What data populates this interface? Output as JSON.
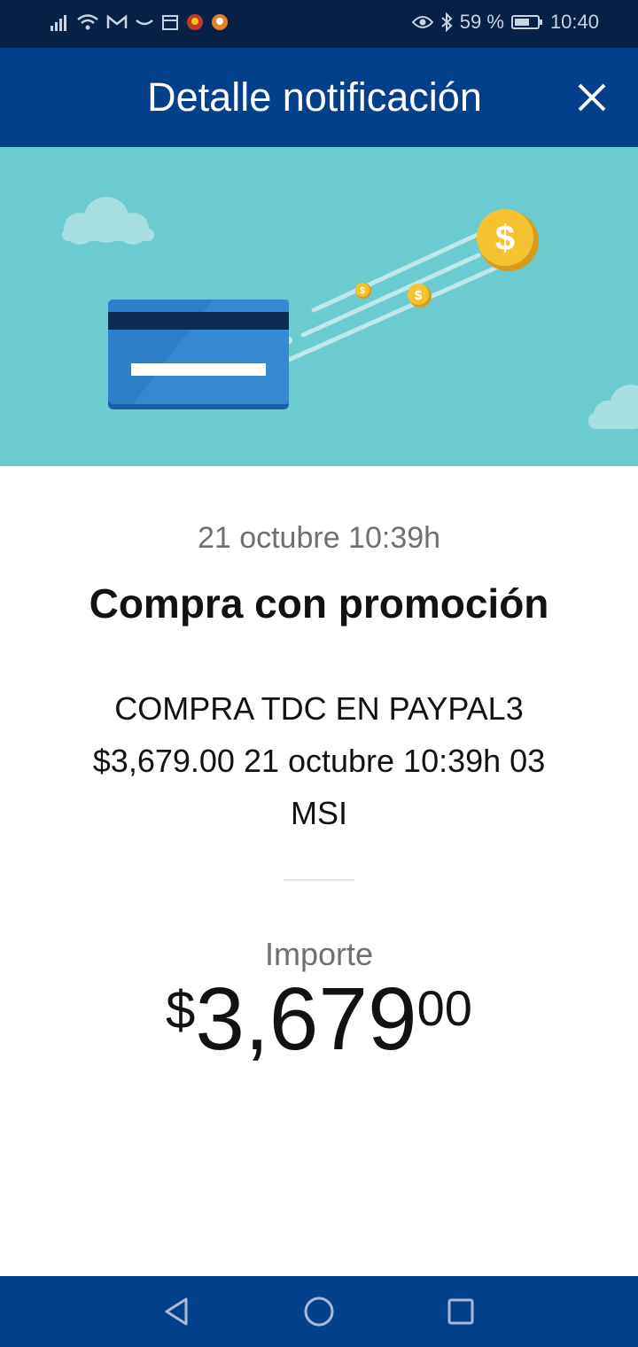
{
  "status_bar": {
    "battery": "59 %",
    "time": "10:40",
    "icons": [
      "signal-icon",
      "wifi-icon",
      "gmail-icon",
      "smile-icon",
      "calendar-icon",
      "app-icon",
      "app-icon",
      "eye-icon",
      "bluetooth-icon",
      "battery-icon"
    ]
  },
  "header": {
    "title": "Detalle notificación",
    "close_icon": "close-icon"
  },
  "notification": {
    "date": "21 octubre 10:39h",
    "title": "Compra con promoción",
    "description": "COMPRA TDC EN PAYPAL3 $3,679.00 21 octubre 10:39h 03 MSI"
  },
  "amount": {
    "label": "Importe",
    "currency": "$",
    "integer": "3,679",
    "cents": "00"
  },
  "nav": {
    "icons": [
      "back-icon",
      "home-icon",
      "recents-icon"
    ]
  },
  "colors": {
    "status_bar": "#072146",
    "header": "#043f8c",
    "hero_bg": "#6bcbd0",
    "card": "#2d7fc8",
    "coin": "#f5c230"
  }
}
